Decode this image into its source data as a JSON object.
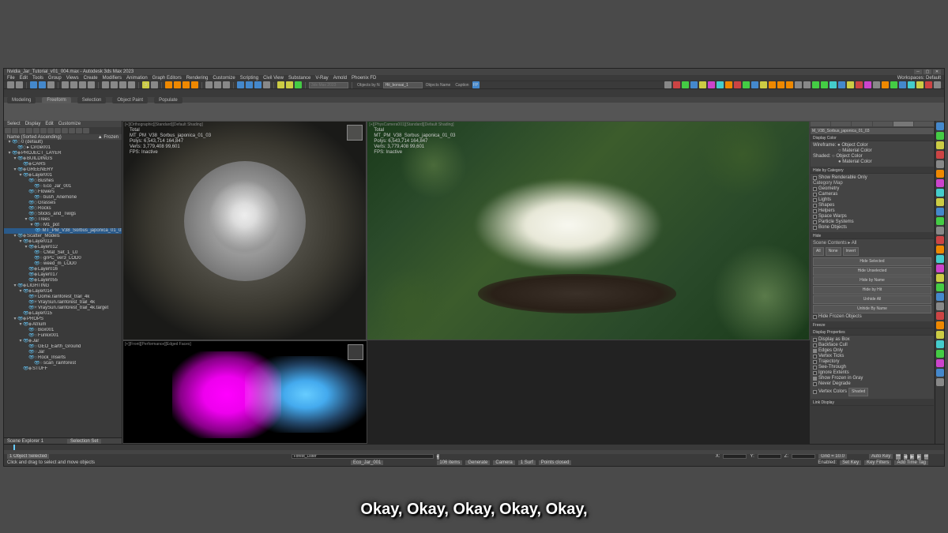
{
  "title": "Nvidia_Jar_Tutorial_v01_004.max - Autodesk 3ds Max 2023",
  "menu": [
    "File",
    "Edit",
    "Tools",
    "Group",
    "Views",
    "Create",
    "Modifiers",
    "Animation",
    "Graph Editors",
    "Rendering",
    "Customize",
    "Scripting",
    "Civil View",
    "Substance",
    "V-Ray",
    "Arnold",
    "Phoenix FD"
  ],
  "topbar_workspace": "Workspaces: Default",
  "search_placeholder": "3ds Max 2023",
  "typein_label": "Objects by N",
  "typein_value": "Hit_bonsai_1",
  "typein_mode": "Objects Name",
  "typein_btn": "Caption",
  "ribbon": {
    "tabs": [
      "Modeling",
      "Freeform",
      "Selection",
      "Object Paint",
      "Populate"
    ],
    "active": 1
  },
  "scene_explorer": {
    "tabs": [
      "Select",
      "Display",
      "Edit",
      "Customize"
    ],
    "header_left": "Name (Sorted Ascending)",
    "header_right": "▲ Frozen",
    "footer": "Scene Explorer 1",
    "selset": "Selection Set",
    "items": [
      {
        "d": 0,
        "t": "▾",
        "i": "◇",
        "n": "0 (default)"
      },
      {
        "d": 1,
        "t": "",
        "i": "◇",
        "n": "▸ Circle001"
      },
      {
        "d": 0,
        "t": "▾",
        "i": "◆",
        "n": "PROJECT_LAYER"
      },
      {
        "d": 1,
        "t": "▾",
        "i": "◆",
        "n": "BUILDINGS"
      },
      {
        "d": 2,
        "t": "",
        "i": "◆",
        "n": "CARS"
      },
      {
        "d": 1,
        "t": "▾",
        "i": "◆",
        "n": "GREENERY"
      },
      {
        "d": 2,
        "t": "▾",
        "i": "◆",
        "n": "Layer001"
      },
      {
        "d": 3,
        "t": "",
        "i": "◇",
        "n": "Bushes"
      },
      {
        "d": 4,
        "t": "",
        "i": "○",
        "n": "Eco_Jar_001"
      },
      {
        "d": 3,
        "t": "",
        "i": "◇",
        "n": "Flowers"
      },
      {
        "d": 4,
        "t": "",
        "i": "○",
        "n": "bush_Anemone"
      },
      {
        "d": 3,
        "t": "",
        "i": "◇",
        "n": "Grasses"
      },
      {
        "d": 3,
        "t": "",
        "i": "◇",
        "n": "Rocks"
      },
      {
        "d": 3,
        "t": "",
        "i": "◇",
        "n": "Sticks_and_Twigs"
      },
      {
        "d": 3,
        "t": "▾",
        "i": "◇",
        "n": "Trees"
      },
      {
        "d": 4,
        "t": "▾",
        "i": "○",
        "n": "M1_pot"
      },
      {
        "d": 5,
        "t": "",
        "i": "○",
        "n": "MT_PM_V38_Sorbus_japonica_01_03",
        "sel": true
      },
      {
        "d": 1,
        "t": "▾",
        "i": "◆",
        "n": "Scatter_Models"
      },
      {
        "d": 2,
        "t": "▾",
        "i": "◆",
        "n": "Layer013"
      },
      {
        "d": 3,
        "t": "▾",
        "i": "◆",
        "n": "Layer012"
      },
      {
        "d": 4,
        "t": "",
        "i": "○",
        "n": "CMat_Set_1_L0"
      },
      {
        "d": 4,
        "t": "",
        "i": "○",
        "n": "grPC_ver3_LOD0"
      },
      {
        "d": 4,
        "t": "",
        "i": "○",
        "n": "weed_m_LOD0"
      },
      {
        "d": 3,
        "t": "",
        "i": "◆",
        "n": "Layer016"
      },
      {
        "d": 3,
        "t": "",
        "i": "◆",
        "n": "Layer017"
      },
      {
        "d": 3,
        "t": "",
        "i": "◆",
        "n": "Layer055"
      },
      {
        "d": 1,
        "t": "▾",
        "i": "◆",
        "n": "LIGHTING"
      },
      {
        "d": 2,
        "t": "▾",
        "i": "◆",
        "n": "Layer014"
      },
      {
        "d": 3,
        "t": "",
        "i": "☀",
        "n": "Dome.rainforest_trail_4k"
      },
      {
        "d": 3,
        "t": "",
        "i": "☀",
        "n": "VraySun.rainforest_trail_4k"
      },
      {
        "d": 3,
        "t": "",
        "i": "☀",
        "n": "VraySun.rainforest_trail_4k.target"
      },
      {
        "d": 2,
        "t": "",
        "i": "◆",
        "n": "Layer015"
      },
      {
        "d": 1,
        "t": "▾",
        "i": "◆",
        "n": "PROPS"
      },
      {
        "d": 2,
        "t": "▾",
        "i": "◆",
        "n": "Atrium"
      },
      {
        "d": 3,
        "t": "",
        "i": "○",
        "n": "Box001"
      },
      {
        "d": 3,
        "t": "",
        "i": "○",
        "n": "Funkx001"
      },
      {
        "d": 2,
        "t": "▾",
        "i": "◆",
        "n": "Jar"
      },
      {
        "d": 3,
        "t": "",
        "i": "○",
        "n": "GEO_Earth_Ground"
      },
      {
        "d": 3,
        "t": "",
        "i": "○",
        "n": "Jar"
      },
      {
        "d": 3,
        "t": "",
        "i": "○",
        "n": "Rock_Inserts"
      },
      {
        "d": 4,
        "t": "",
        "i": "○",
        "n": "scan_rainforest"
      },
      {
        "d": 2,
        "t": "",
        "i": "◆",
        "n": "STUFF"
      }
    ]
  },
  "viewports": {
    "v1": {
      "label": "[+][Orthographic][Standard][Default Shading]",
      "stats": {
        "l1": "Total",
        "l2": "MT_PM_V38_Sorbus_japonica_01_03",
        "l3": "Polys: 6,543,714   164,847",
        "l4": "Verts: 3,779,408   99,601",
        "l5": "FPS:    Inactive"
      }
    },
    "v2": {
      "label": "[+][PhysCamera001][Standard][Default Shading]",
      "stats": {
        "l1": "Total",
        "l2": "MT_PM_V38_Sorbus_japonica_01_03",
        "l3": "Polys: 6,543,714   164,847",
        "l4": "Verts: 3,779,408   99,601",
        "l5": "FPS:    Inactive"
      }
    },
    "v3": {
      "label": "[+][Front][Performance][Edged Faces]"
    }
  },
  "cmdpanel": {
    "objname": "M_V38_Sorbus_japonica_01_03",
    "rollouts": {
      "display_color": {
        "title": "Display Color",
        "items": [
          "Wireframe:",
          "Shaded:"
        ],
        "opts": [
          "Object Color",
          "Material Color"
        ]
      },
      "hide_cat": {
        "title": "Hide by Category",
        "chk": "Show Renderable Only",
        "cat": "Category   Map",
        "items": [
          "Geometry",
          "Cameras",
          "Lights",
          "Shapes",
          "Helpers",
          "Space Warps",
          "Particle Systems",
          "Bone Objects"
        ]
      },
      "hide": {
        "title": "Hide",
        "scene": "Scene Contents ▸ All",
        "tabs": [
          "All",
          "None",
          "Invert"
        ],
        "btns": [
          "Hide Selected",
          "Hide Unselected",
          "Hide by Name",
          "Hide by Hit",
          "Unhide All",
          "Unhide By Name",
          "Hide Frozen Objects"
        ]
      },
      "freeze": {
        "title": "Freeze"
      },
      "display_props": {
        "title": "Display Properties",
        "items": [
          "Display as Box",
          "Backface Cull",
          "Edges Only",
          "Vertex Ticks",
          "Trajectory",
          "See-Through",
          "Ignore Extents",
          "Show Frozen in Gray",
          "Never Degrade",
          "Vertex Colors"
        ],
        "btn": "Shaded"
      },
      "link_display": {
        "title": "Link Display"
      }
    }
  },
  "status": {
    "sel": "1 Object Selected",
    "hint": "Click and drag to select and move objects",
    "forest_input": "Forest_Lister",
    "forest_count": "106 items",
    "forest_btns": [
      "Generate",
      "Camera",
      "1 Surf",
      "Points closed"
    ],
    "eco": "Eco_Jar_001",
    "coords": [
      "X:",
      "Y:",
      "Z:"
    ],
    "grid": "Grid = 10.0",
    "autokey": "Auto Key",
    "setkey": "Set Key",
    "keyfilters": "Key Filters",
    "addtag": "Add Time Tag",
    "enabled": "Enabled:"
  },
  "subtitle": "Okay, Okay, Okay, Okay, Okay,"
}
